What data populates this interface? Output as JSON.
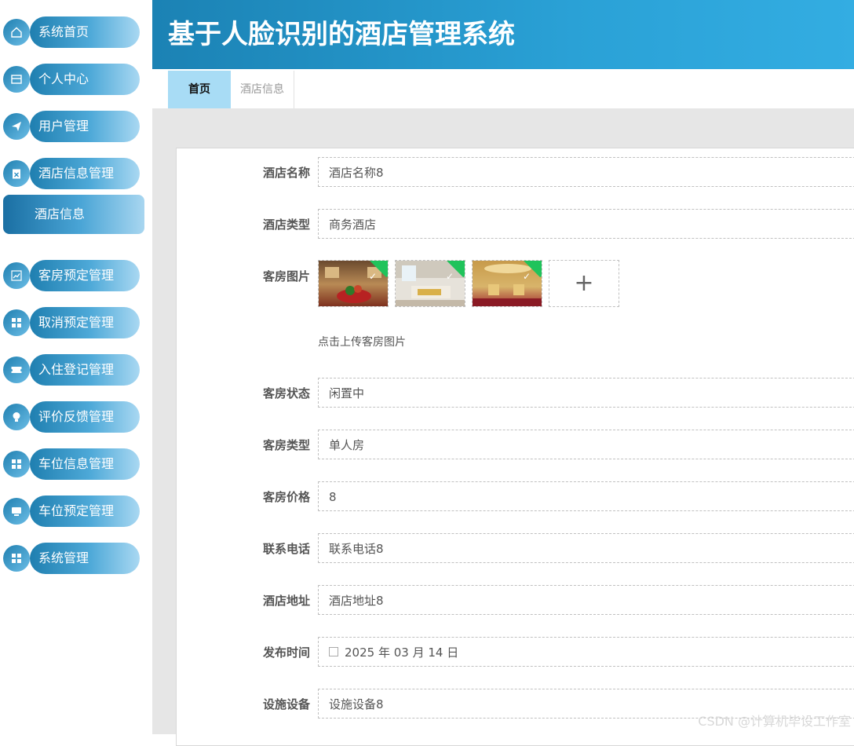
{
  "app": {
    "title": "基于人脸识别的酒店管理系统"
  },
  "sidebar": {
    "items": [
      {
        "label": "系统首页",
        "icon": "home-icon"
      },
      {
        "label": "个人中心",
        "icon": "wallet-icon"
      },
      {
        "label": "用户管理",
        "icon": "paper-plane-icon"
      },
      {
        "label": "酒店信息管理",
        "icon": "clipboard-icon"
      },
      {
        "label": "客房预定管理",
        "icon": "chart-icon"
      },
      {
        "label": "取消预定管理",
        "icon": "grid-icon"
      },
      {
        "label": "入住登记管理",
        "icon": "ticket-icon"
      },
      {
        "label": "评价反馈管理",
        "icon": "bulb-icon"
      },
      {
        "label": "车位信息管理",
        "icon": "grid-icon"
      },
      {
        "label": "车位预定管理",
        "icon": "monitor-icon"
      },
      {
        "label": "系统管理",
        "icon": "grid-icon"
      }
    ],
    "sub_item": "酒店信息"
  },
  "tabs": {
    "home": "首页",
    "hotel_info": "酒店信息"
  },
  "form": {
    "hotel_name": {
      "label": "酒店名称",
      "value": "酒店名称8"
    },
    "hotel_type": {
      "label": "酒店类型",
      "value": "商务酒店"
    },
    "room_images": {
      "label": "客房图片",
      "upload_hint": "点击上传客房图片",
      "add_symbol": "+",
      "check_mark": "✓"
    },
    "room_status": {
      "label": "客房状态",
      "value": "闲置中"
    },
    "room_type": {
      "label": "客房类型",
      "value": "单人房"
    },
    "room_price": {
      "label": "客房价格",
      "value": "8"
    },
    "phone": {
      "label": "联系电话",
      "value": "联系电话8"
    },
    "address": {
      "label": "酒店地址",
      "value": "酒店地址8"
    },
    "publish_time": {
      "label": "发布时间",
      "value": "2025 年 03 月 14 日"
    },
    "facilities": {
      "label": "设施设备",
      "value": "设施设备8"
    }
  },
  "watermark": "CSDN @计算机毕设工作室",
  "colors": {
    "header": "#2aa1d6",
    "tab_active": "#a8dcf5",
    "upload_ok": "#20c35b"
  }
}
